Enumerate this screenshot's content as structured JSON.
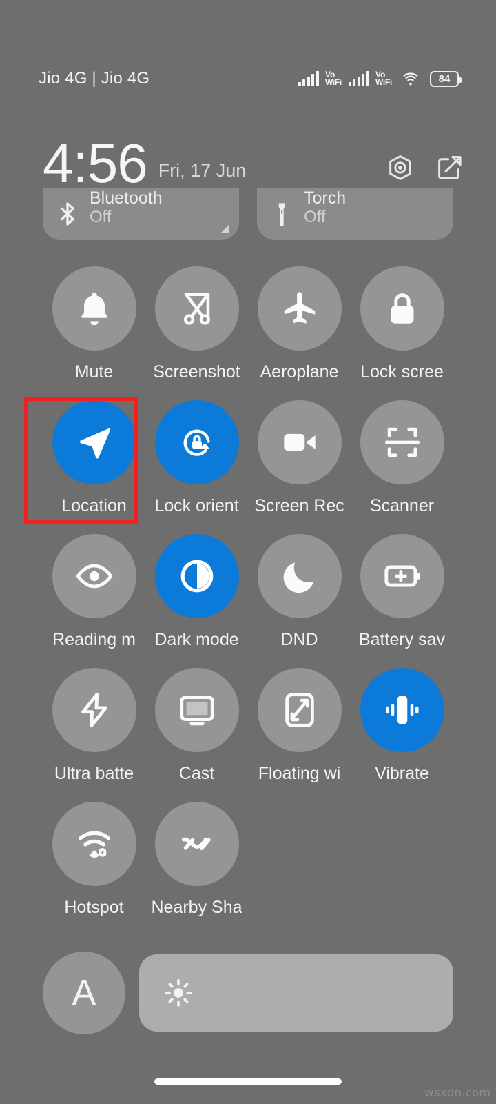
{
  "status_bar": {
    "carriers": "Jio 4G | Jio 4G",
    "signal_1_label": "Vo",
    "signal_1_sub": "WiFi",
    "signal_2_label": "Vo",
    "signal_2_sub": "WiFi",
    "wifi_icon": "wifi-icon",
    "battery_level": "84"
  },
  "header": {
    "time": "4:56",
    "date": "Fri, 17 Jun",
    "settings_icon": "settings-gear-icon",
    "edit_icon": "edit-pencil-icon"
  },
  "top_pills": [
    {
      "title": "Bluetooth",
      "status": "Off",
      "icon": "bluetooth-icon"
    },
    {
      "title": "Torch",
      "status": "Off",
      "icon": "torch-icon"
    }
  ],
  "tiles": [
    [
      {
        "label": "Mute",
        "icon": "bell-icon",
        "active": false
      },
      {
        "label": "Screenshot",
        "icon": "scissors-screenshot-icon",
        "active": false
      },
      {
        "label": "Aeroplane ",
        "icon": "aeroplane-icon",
        "active": false
      },
      {
        "label": "Lock scree",
        "icon": "lock-icon",
        "active": false
      }
    ],
    [
      {
        "label": "Location",
        "icon": "location-arrow-icon",
        "active": true
      },
      {
        "label": "Lock orient",
        "icon": "lock-rotation-icon",
        "active": true
      },
      {
        "label": "Screen Rec",
        "icon": "video-camera-icon",
        "active": false
      },
      {
        "label": "Scanner",
        "icon": "scan-frame-icon",
        "active": false
      }
    ],
    [
      {
        "label": "Reading m",
        "icon": "eye-icon",
        "active": false
      },
      {
        "label": "Dark mode",
        "icon": "contrast-circle-icon",
        "active": true
      },
      {
        "label": "DND",
        "icon": "moon-icon",
        "active": false
      },
      {
        "label": "Battery sav",
        "icon": "battery-plus-icon",
        "active": false
      }
    ],
    [
      {
        "label": "Ultra batte",
        "icon": "lightning-bolt-icon",
        "active": false
      },
      {
        "label": "Cast",
        "icon": "monitor-cast-icon",
        "active": false
      },
      {
        "label": "Floating wi",
        "icon": "floating-window-icon",
        "active": false
      },
      {
        "label": "Vibrate",
        "icon": "vibrate-icon",
        "active": true
      }
    ],
    [
      {
        "label": "Hotspot",
        "icon": "hotspot-icon",
        "active": false
      },
      {
        "label": "Nearby Sha",
        "icon": "nearby-share-icon",
        "active": false
      }
    ]
  ],
  "brightness": {
    "auto_label": "A",
    "slider_icon": "brightness-sun-icon"
  },
  "highlight": {
    "target": "Location",
    "color": "#f41f1f"
  },
  "watermark": "wsxdn.com",
  "colors": {
    "background": "#6f6e6e",
    "tile_off": "#969595",
    "tile_on": "#0b7ad8",
    "pill": "#8c8b8b",
    "slider_track": "#adadad",
    "text": "#f3f3f3"
  }
}
